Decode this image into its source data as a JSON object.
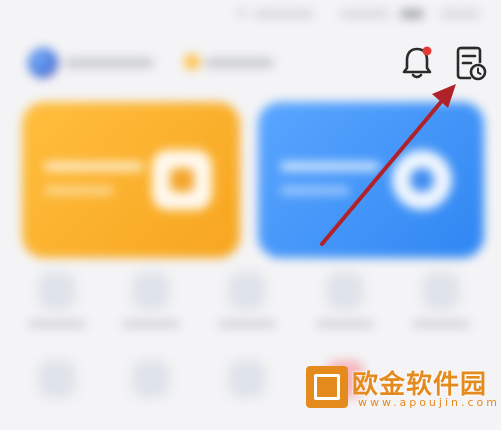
{
  "header": {
    "notification_icon": "bell-icon",
    "notification_badge_color": "#e53935",
    "records_icon": "document-clock-icon"
  },
  "colors": {
    "card_orange": "#f7a51f",
    "card_blue": "#2f86f2",
    "annotation_arrow": "#b0222a",
    "icon_stroke": "#2b2b2b",
    "watermark": "#e58a1d"
  },
  "watermark": {
    "title": "欧金软件园",
    "url": "www.apoujin.com"
  }
}
